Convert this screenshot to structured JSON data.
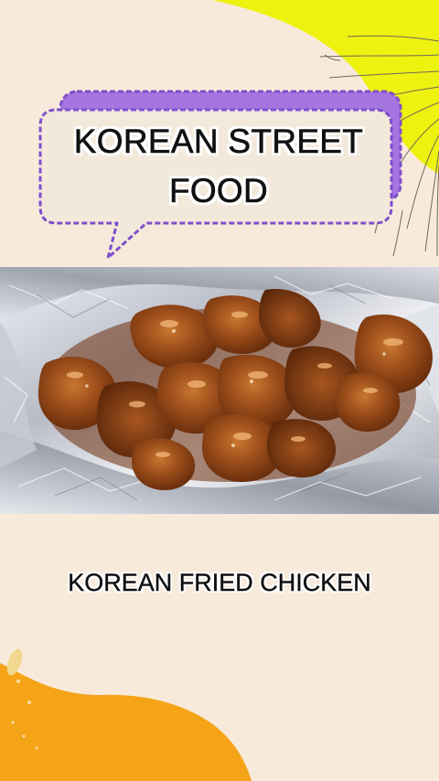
{
  "headline": {
    "line1": "KOREAN STREET",
    "line2": "FOOD"
  },
  "caption": "KOREAN FRIED CHICKEN",
  "photo": {
    "subject": "korean-fried-chicken-on-foil"
  },
  "colors": {
    "background": "#f8eadb",
    "accent_yellow": "#eef20f",
    "bubble_purple": "#a575e0",
    "bubble_border": "#7f4fcc",
    "bubble_fill": "#f3e9db",
    "bottom_orange": "#f5a418",
    "text": "#111111"
  }
}
